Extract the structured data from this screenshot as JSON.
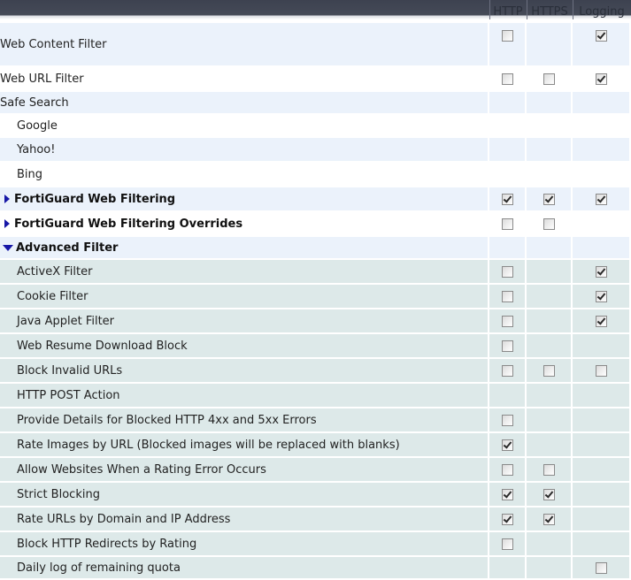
{
  "header": {
    "http": "HTTP",
    "https": "HTTPS",
    "logging": "Logging"
  },
  "rows": [
    {
      "label": "Web Content Filter",
      "http": false,
      "https": null,
      "logging": true
    },
    {
      "label": "Web URL Filter",
      "http": false,
      "https": false,
      "logging": true
    },
    {
      "label": "Safe Search",
      "http": null,
      "https": null,
      "logging": null
    },
    {
      "label": "Google",
      "http": null,
      "https": null,
      "logging": null
    },
    {
      "label": "Yahoo!",
      "http": null,
      "https": null,
      "logging": null
    },
    {
      "label": "Bing",
      "http": null,
      "https": null,
      "logging": null
    },
    {
      "label": "FortiGuard Web Filtering",
      "http": true,
      "https": true,
      "logging": true,
      "expander": "collapsed"
    },
    {
      "label": "FortiGuard Web Filtering Overrides",
      "http": false,
      "https": false,
      "logging": null,
      "expander": "collapsed"
    },
    {
      "label": "Advanced Filter",
      "http": null,
      "https": null,
      "logging": null,
      "expander": "expanded"
    },
    {
      "label": "ActiveX Filter",
      "http": false,
      "https": null,
      "logging": true
    },
    {
      "label": "Cookie Filter",
      "http": false,
      "https": null,
      "logging": true
    },
    {
      "label": "Java Applet Filter",
      "http": false,
      "https": null,
      "logging": true
    },
    {
      "label": "Web Resume Download Block",
      "http": false,
      "https": null,
      "logging": null
    },
    {
      "label": "Block Invalid URLs",
      "http": false,
      "https": false,
      "logging": false
    },
    {
      "label": "HTTP POST Action",
      "http": null,
      "https": null,
      "logging": null
    },
    {
      "label": "Provide Details for Blocked HTTP 4xx and 5xx Errors",
      "http": false,
      "https": null,
      "logging": null
    },
    {
      "label": "Rate Images by URL (Blocked images will be replaced with blanks)",
      "http": true,
      "https": null,
      "logging": null
    },
    {
      "label": "Allow Websites When a Rating Error Occurs",
      "http": false,
      "https": false,
      "logging": null
    },
    {
      "label": "Strict Blocking",
      "http": true,
      "https": true,
      "logging": null
    },
    {
      "label": "Rate URLs by Domain and IP Address",
      "http": true,
      "https": true,
      "logging": null
    },
    {
      "label": "Block HTTP Redirects by Rating",
      "http": false,
      "https": null,
      "logging": null
    },
    {
      "label": "Daily log of remaining quota",
      "http": null,
      "https": null,
      "logging": false
    }
  ]
}
